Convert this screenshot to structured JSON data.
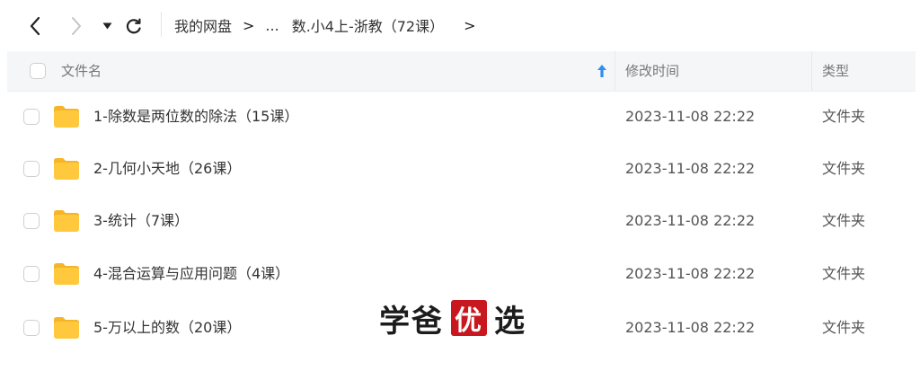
{
  "breadcrumb": {
    "root": "我的网盘",
    "separator": ">",
    "ellipsis": "...",
    "current": "数.小4上-浙教（72课）",
    "trailing_separator": ">"
  },
  "table": {
    "columns": {
      "name": "文件名",
      "modified": "修改时间",
      "type": "类型"
    },
    "sort": {
      "column": "name",
      "direction": "ascending",
      "icon": "arrow-up-icon"
    },
    "rows": [
      {
        "name": "1-除数是两位数的除法（15课）",
        "modified": "2023-11-08 22:22",
        "type": "文件夹"
      },
      {
        "name": "2-几何小天地（26课）",
        "modified": "2023-11-08 22:22",
        "type": "文件夹"
      },
      {
        "name": "3-统计（7课）",
        "modified": "2023-11-08 22:22",
        "type": "文件夹"
      },
      {
        "name": "4-混合运算与应用问题（4课）",
        "modified": "2023-11-08 22:22",
        "type": "文件夹"
      },
      {
        "name": "5-万以上的数（20课）",
        "modified": "2023-11-08 22:22",
        "type": "文件夹"
      }
    ]
  },
  "watermark": {
    "part1": "学爸",
    "seal": "优",
    "part2": "选"
  },
  "colors": {
    "folder": "#FFC83D",
    "folder_tab": "#F5B526",
    "accent": "#2F8FF0",
    "seal": "#C8171E"
  }
}
